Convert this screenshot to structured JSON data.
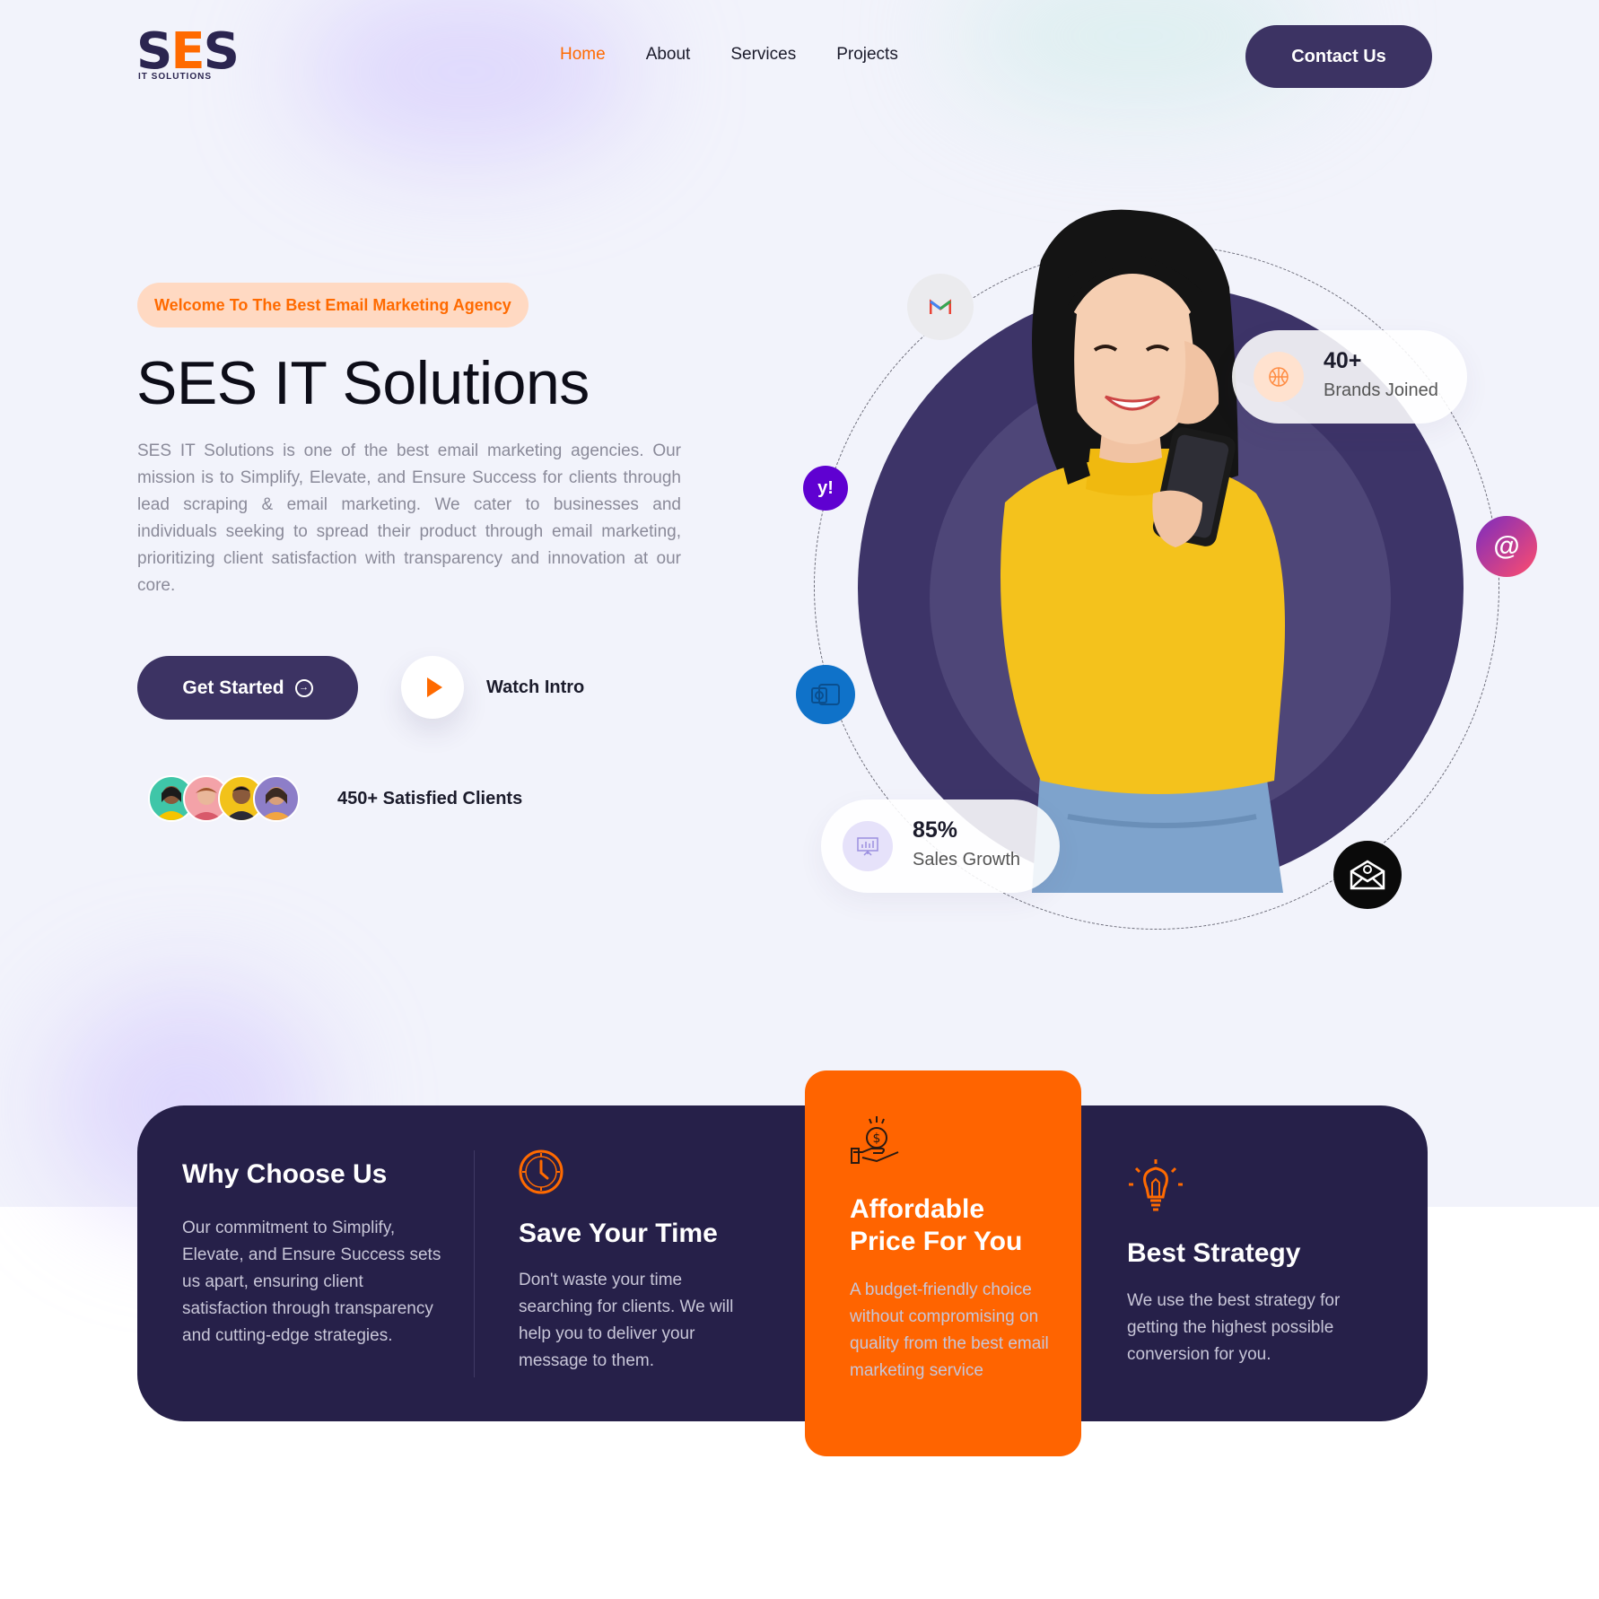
{
  "header": {
    "logo_text": "SES",
    "logo_sub": "IT SOLUTIONS",
    "nav": [
      "Home",
      "About",
      "Services",
      "Projects"
    ],
    "contact_label": "Contact Us"
  },
  "hero": {
    "badge": "Welcome To The Best Email Marketing Agency",
    "title": "SES IT Solutions",
    "description": "SES IT Solutions is one of the best email marketing agencies. Our mission is to Simplify, Elevate, and Ensure Success for clients through lead scraping & email marketing. We cater to businesses and individuals seeking to spread their product through email marketing, prioritizing client satisfaction with transparency and innovation at our core.",
    "get_started_label": "Get Started",
    "watch_label": "Watch Intro",
    "clients_label": "450+ Satisfied Clients"
  },
  "stats": {
    "brands_value": "40+",
    "brands_label": "Brands Joined",
    "growth_value": "85%",
    "growth_label": "Sales Growth"
  },
  "floating_icons": [
    "gmail-icon",
    "yahoo-icon",
    "outlook-icon",
    "at-sign-icon",
    "mail-envelope-icon"
  ],
  "features": {
    "why_title": "Why Choose Us",
    "why_text": "Our commitment to Simplify, Elevate, and Ensure Success sets us apart, ensuring client satisfaction through transparency and cutting-edge strategies.",
    "items": [
      {
        "icon": "clock-icon",
        "title": "Save Your Time",
        "text": "Don't waste your time searching for clients. We will help you to deliver your message to them."
      },
      {
        "icon": "money-hand-icon",
        "title": "Affordable Price For You",
        "text": "A budget-friendly choice without compromising on quality from the best email marketing service"
      },
      {
        "icon": "lightbulb-icon",
        "title": "Best Strategy",
        "text": "We use the best strategy for getting the highest possible conversion for you."
      }
    ]
  },
  "colors": {
    "primary": "#3c3363",
    "accent": "#ff6a00",
    "dark_band": "#262049",
    "page_bg": "#f2f3fb"
  }
}
